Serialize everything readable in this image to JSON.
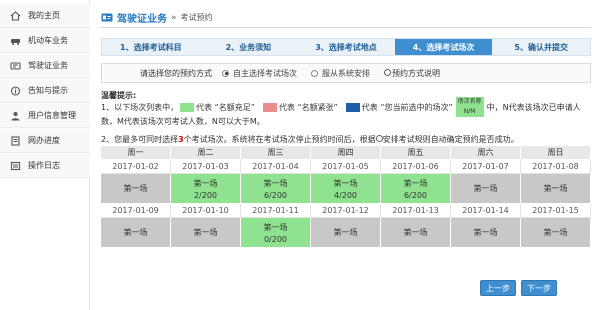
{
  "sidebar": {
    "items": [
      {
        "label": "我的主页",
        "icon": "home-icon"
      },
      {
        "label": "机动车业务",
        "icon": "car-icon"
      },
      {
        "label": "驾驶证业务",
        "icon": "license-card-icon"
      },
      {
        "label": "告知与提示",
        "icon": "info-icon"
      },
      {
        "label": "用户信息管理",
        "icon": "user-icon"
      },
      {
        "label": "网办进度",
        "icon": "document-icon"
      },
      {
        "label": "操作日志",
        "icon": "log-icon"
      }
    ]
  },
  "header": {
    "module": "驾驶证业务",
    "separator": "»",
    "page": "考试预约"
  },
  "steps": [
    {
      "label": "1、选择考试科目",
      "active": false
    },
    {
      "label": "2、业务须知",
      "active": false
    },
    {
      "label": "3、选择考试地点",
      "active": false
    },
    {
      "label": "4、选择考试场次",
      "active": true
    },
    {
      "label": "5、确认并提交",
      "active": false
    }
  ],
  "mode": {
    "question": "请选择您的预约方式",
    "option1": "自主选择考试场次",
    "option2": "服从系统安排",
    "link": "预约方式说明"
  },
  "tips": {
    "title": "温馨提示:",
    "line1_a": "1、以下场次列表中，",
    "line1_green": "代表 “名额充足”",
    "line1_pink": "代表 “名额紧张”",
    "line1_blue": "代表 “您当前选中的场次”",
    "mini_label_1": "场次名称",
    "mini_label_2": "N/M",
    "line1_b": "中，N代表该场次已申请人",
    "line1_c": "数，M代表该场次可考试人数，N可以大于M。",
    "line2_a": "2、您最多可同时选择",
    "line2_num": "3",
    "line2_b": "个考试场次。系统将在考试场次停止预约时间后，根据",
    "line2_link": "安排考试规则",
    "line2_c": "自动确定预约是否成功。"
  },
  "calendar": {
    "weekdays": [
      "周一",
      "周二",
      "周三",
      "周四",
      "周五",
      "周六",
      "周日"
    ],
    "week1_dates": [
      "2017-01-02",
      "2017-01-03",
      "2017-01-04",
      "2017-01-05",
      "2017-01-06",
      "2017-01-07",
      "2017-01-08"
    ],
    "week1_sessions": [
      {
        "name": "第一场",
        "count": "",
        "available": false
      },
      {
        "name": "第一场",
        "count": "2/200",
        "available": true
      },
      {
        "name": "第一场",
        "count": "6/200",
        "available": true
      },
      {
        "name": "第一场",
        "count": "4/200",
        "available": true
      },
      {
        "name": "第一场",
        "count": "6/200",
        "available": true
      },
      {
        "name": "第一场",
        "count": "",
        "available": false
      },
      {
        "name": "第一场",
        "count": "",
        "available": false
      }
    ],
    "week2_dates": [
      "2017-01-09",
      "2017-01-10",
      "2017-01-11",
      "2017-01-12",
      "2017-01-13",
      "2017-01-14",
      "2017-01-15"
    ],
    "week2_sessions": [
      {
        "name": "第一场",
        "count": "",
        "available": false
      },
      {
        "name": "第一场",
        "count": "",
        "available": false
      },
      {
        "name": "第一场",
        "count": "0/200",
        "available": true
      },
      {
        "name": "第一场",
        "count": "",
        "available": false
      },
      {
        "name": "第一场",
        "count": "",
        "available": false
      },
      {
        "name": "第一场",
        "count": "",
        "available": false
      },
      {
        "name": "第一场",
        "count": "",
        "available": false
      }
    ]
  },
  "buttons": {
    "prev": "上一步",
    "next": "下一步"
  },
  "colors": {
    "accent": "#3e8ed0",
    "available": "#8fe28f",
    "tight": "#e98d8d",
    "selected": "#1f5fa8",
    "unavailable": "#c8c8c8"
  }
}
